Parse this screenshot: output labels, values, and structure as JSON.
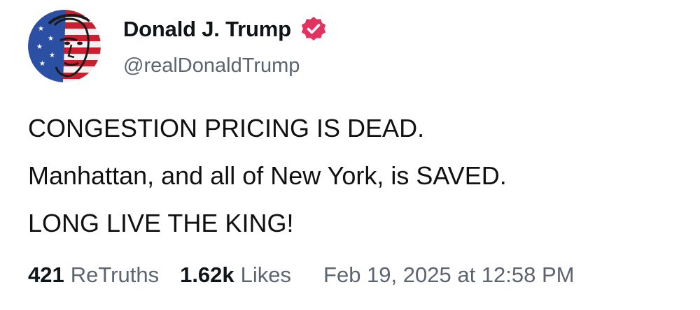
{
  "author": {
    "display_name": "Donald J. Trump",
    "handle": "@realDonaldTrump",
    "verified": true,
    "avatar_icon": "flag-portrait-avatar",
    "badge_color": "#e4325f"
  },
  "post": {
    "lines": [
      "CONGESTION PRICING IS DEAD.",
      "Manhattan, and all of New York, is SAVED.",
      "LONG LIVE THE KING!"
    ]
  },
  "stats": {
    "retruths_count": "421",
    "retruths_label": "ReTruths",
    "likes_count": "1.62k",
    "likes_label": "Likes",
    "timestamp": "Feb 19, 2025 at 12:58 PM"
  }
}
